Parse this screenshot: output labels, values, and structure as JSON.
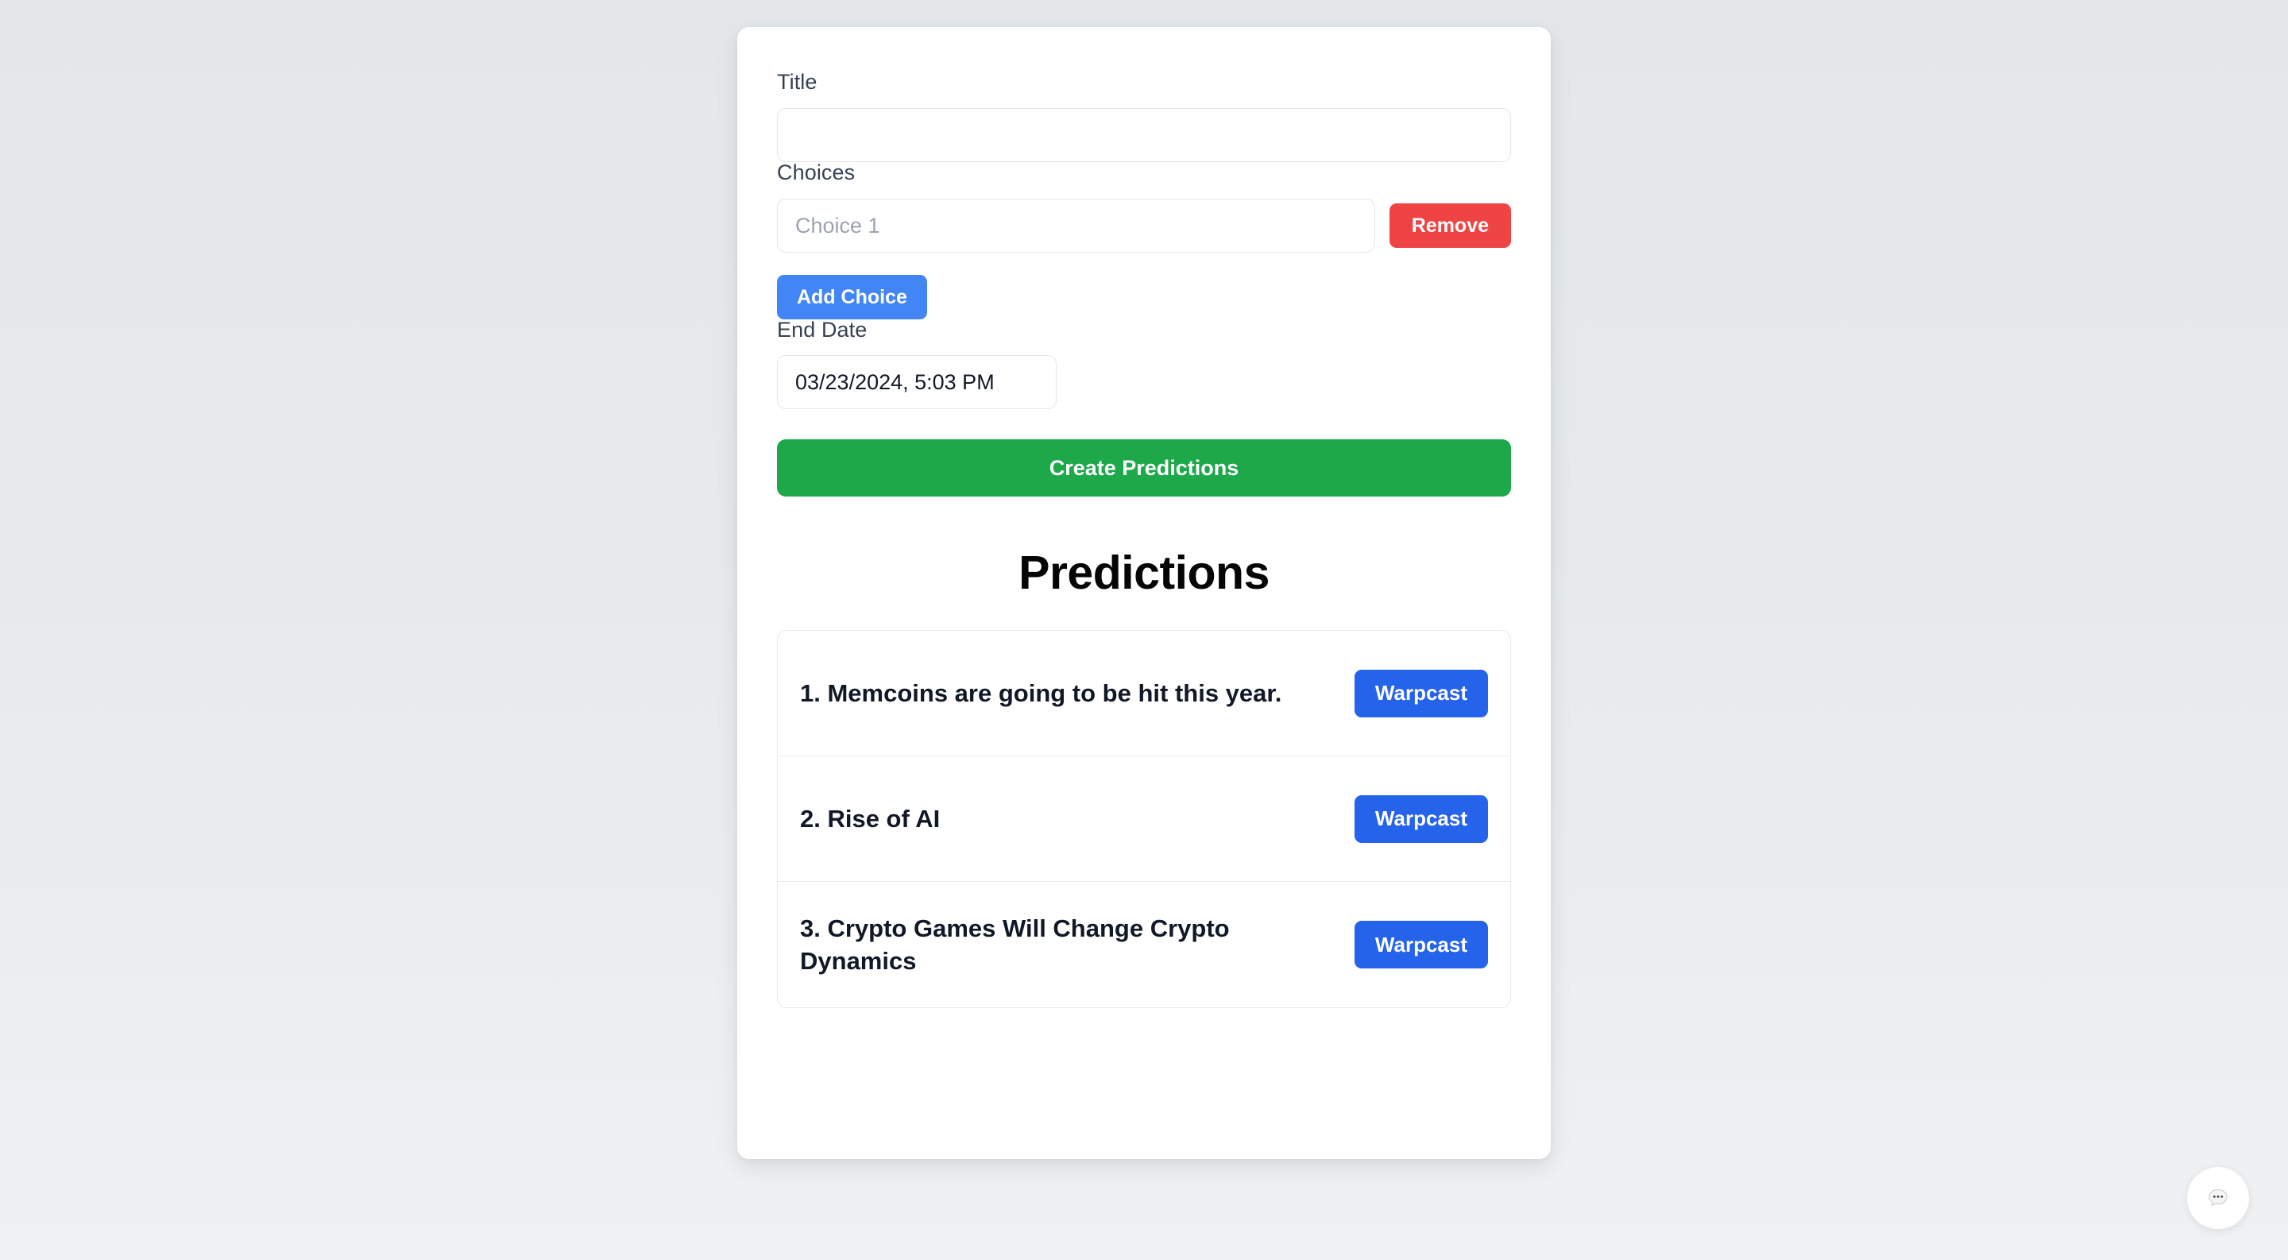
{
  "form": {
    "title_label": "Title",
    "title_value": "",
    "title_placeholder": "",
    "choices_label": "Choices",
    "choice_placeholder": "Choice 1",
    "choice_value": "",
    "remove_label": "Remove",
    "add_choice_label": "Add Choice",
    "end_date_label": "End Date",
    "end_date_value": "03/23/2024, 5:03 PM",
    "create_label": "Create Predictions"
  },
  "predictions": {
    "heading": "Predictions",
    "items": [
      {
        "text": "1. Memcoins are going to be hit this year.",
        "action_label": "Warpcast"
      },
      {
        "text": "2. Rise of AI",
        "action_label": "Warpcast"
      },
      {
        "text": "3. Crypto Games Will Change Crypto Dynamics",
        "action_label": "Warpcast"
      }
    ]
  },
  "chat": {
    "icon": "chat-bubble-icon"
  },
  "colors": {
    "background": "#e3e7e9",
    "card": "#ffffff",
    "remove": "#ef4444",
    "add_choice": "#4285f4",
    "create": "#1da84a",
    "warpcast": "#2563eb",
    "label_text": "#374151",
    "heading_text": "#050505"
  }
}
